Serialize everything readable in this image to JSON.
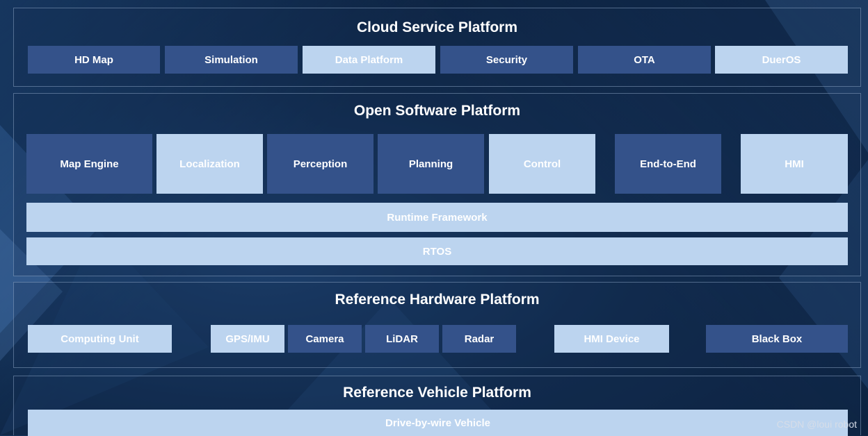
{
  "cloud": {
    "title": "Cloud Service Platform",
    "items": [
      "HD Map",
      "Simulation",
      "Data Platform",
      "Security",
      "OTA",
      "DuerOS"
    ]
  },
  "software": {
    "title": "Open Software Platform",
    "modules": [
      "Map Engine",
      "Localization",
      "Perception",
      "Planning",
      "Control",
      "End-to-End",
      "HMI"
    ],
    "runtime": "Runtime Framework",
    "rtos": "RTOS"
  },
  "hardware": {
    "title": "Reference Hardware Platform",
    "items": [
      "Computing Unit",
      "GPS/IMU",
      "Camera",
      "LiDAR",
      "Radar",
      "HMI Device",
      "Black Box"
    ]
  },
  "vehicle": {
    "title": "Reference Vehicle Platform",
    "item": "Drive-by-wire Vehicle"
  },
  "watermark": "CSDN @loui robot",
  "colors": {
    "dark_box": "#34528a",
    "light_box": "#bcd4ef",
    "background": "#102a4c"
  }
}
